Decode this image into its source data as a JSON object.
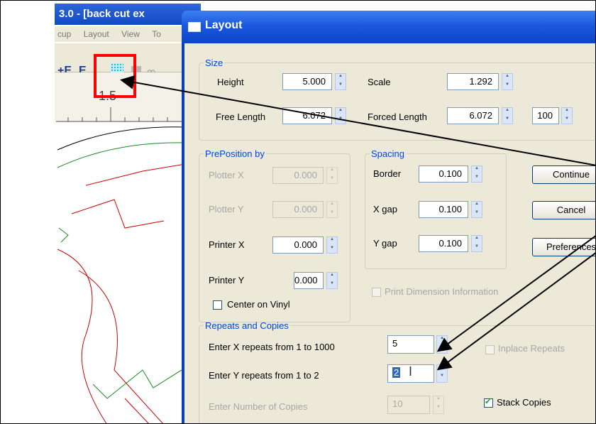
{
  "app": {
    "title": "3.0 - [back cut ex",
    "menu": [
      "cup",
      "Layout",
      "View",
      "To"
    ],
    "ruler_label": "1.5"
  },
  "dialog": {
    "title": "Layout",
    "size": {
      "legend": "Size",
      "height_label": "Height",
      "height_value": "5.000",
      "scale_label": "Scale",
      "scale_value": "1.292",
      "free_length_label": "Free Length",
      "free_length_value": "6.072",
      "forced_length_label": "Forced Length",
      "forced_length_value": "6.072",
      "percent_value": "100"
    },
    "preposition": {
      "legend": "PrePosition by",
      "plotter_x_label": "Plotter X",
      "plotter_x_value": "0.000",
      "plotter_y_label": "Plotter Y",
      "plotter_y_value": "0.000",
      "printer_x_label": "Printer X",
      "printer_x_value": "0.000",
      "printer_y_label": "Printer Y",
      "printer_y_value": "0.000",
      "center_on_vinyl_label": "Center on Vinyl"
    },
    "spacing": {
      "legend": "Spacing",
      "border_label": "Border",
      "border_value": "0.100",
      "xgap_label": "X gap",
      "xgap_value": "0.100",
      "ygap_label": "Y gap",
      "ygap_value": "0.100"
    },
    "print_dimension_label": "Print Dimension Information",
    "buttons": {
      "continue": "Continue",
      "cancel": "Cancel",
      "preferences": "Preferences"
    },
    "repeats": {
      "legend": "Repeats and Copies",
      "x_label": "Enter X repeats from 1 to 1000",
      "x_value": "5",
      "y_label": "Enter Y repeats from 1 to 2",
      "y_value": "2",
      "copies_label": "Enter Number of Copies",
      "copies_value": "10",
      "inplace_label": "Inplace Repeats",
      "stack_label": "Stack Copies",
      "stack_checked": true
    }
  }
}
